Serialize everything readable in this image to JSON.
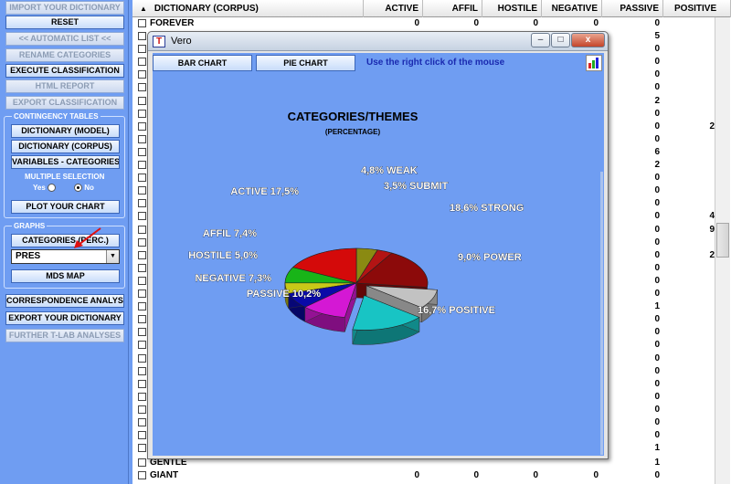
{
  "left_panel": {
    "buttons_top": [
      {
        "label": "IMPORT YOUR DICTIONARY",
        "enabled": false
      },
      {
        "label": "RESET",
        "enabled": true
      },
      {
        "label": "<< AUTOMATIC LIST <<",
        "enabled": false
      },
      {
        "label": "RENAME CATEGORIES",
        "enabled": false
      },
      {
        "label": "EXECUTE CLASSIFICATION",
        "enabled": true
      },
      {
        "label": "HTML REPORT",
        "enabled": false
      },
      {
        "label": "EXPORT CLASSIFICATION",
        "enabled": false
      }
    ],
    "contingency": {
      "title": "CONTINGENCY TABLES",
      "buttons": [
        "DICTIONARY (MODEL)",
        "DICTIONARY (CORPUS)",
        "VARIABLES - CATEGORIES"
      ],
      "multiple_selection": "MULTIPLE SELECTION",
      "yes_label": "Yes",
      "no_label": "No",
      "plot_button": "PLOT YOUR CHART"
    },
    "graphs": {
      "title": "GRAPHS",
      "categories_button": "CATEGORIES (PERC.)",
      "select_value": "PRES",
      "mds_button": "MDS MAP"
    },
    "buttons_bottom": [
      {
        "label": "CORRESPONDENCE ANALYSIS",
        "enabled": true
      },
      {
        "label": "EXPORT YOUR DICTIONARY",
        "enabled": true
      },
      {
        "label": "FURTHER T-LAB ANALYSES",
        "enabled": false
      }
    ]
  },
  "table": {
    "sort_icon": "triangle-up-icon",
    "columns": [
      "DICTIONARY (CORPUS)",
      "ACTIVE",
      "AFFIL",
      "HOSTILE",
      "NEGATIVE",
      "PASSIVE",
      "POSITIVE"
    ],
    "first_row": {
      "word": "FOREVER",
      "values": [
        "0",
        "0",
        "0",
        "0",
        "0",
        ""
      ]
    },
    "passive_column": [
      "5",
      "0",
      "0",
      "0",
      "0",
      "2",
      "0",
      "0",
      "0",
      "6",
      "2",
      "0",
      "0",
      "0",
      "0",
      "0",
      "0",
      "0",
      "0",
      "0",
      "0",
      "1",
      "0",
      "0",
      "0",
      "0",
      "0",
      "0",
      "0",
      "0",
      "0",
      "0",
      "1"
    ],
    "positive_column_partial": [
      {
        "index": 7,
        "value": "2"
      },
      {
        "index": 14,
        "value": "4"
      },
      {
        "index": 15,
        "value": "9"
      },
      {
        "index": 17,
        "value": "2"
      }
    ],
    "partial_row": {
      "word": "GENTLE",
      "passive": "1"
    },
    "last_row": {
      "word": "GIANT",
      "values": [
        "0",
        "0",
        "0",
        "0",
        "0",
        ""
      ]
    }
  },
  "window": {
    "title": "Vero",
    "app_icon_letter": "T",
    "minimize_icon": "minimize-icon",
    "maximize_icon": "maximize-icon",
    "close_icon": "close-icon",
    "minimize_glyph": "–",
    "maximize_glyph": "□",
    "close_glyph": "x",
    "bar_chart_label": "BAR CHART",
    "pie_chart_label": "PIE CHART",
    "hint": "Use the right click of the mouse",
    "toolbar_icon": "chart-export-icon"
  },
  "chart_data": {
    "type": "pie",
    "title": "CATEGORIES/THEMES",
    "subtitle": "(PERCENTAGE)",
    "slices": [
      {
        "name": "WEAK",
        "value": 4.8,
        "label": "4,8%  WEAK",
        "color": "#8a8a12"
      },
      {
        "name": "SUBMIT",
        "value": 3.5,
        "label": "3,5%  SUBMIT",
        "color": "#b31414"
      },
      {
        "name": "STRONG",
        "value": 18.6,
        "label": "18,6%  STRONG",
        "color": "#8c0a0a"
      },
      {
        "name": "POWER",
        "value": 9.0,
        "label": "9,0%  POWER",
        "color": "#c2c2c2"
      },
      {
        "name": "POSITIVE",
        "value": 16.7,
        "label": "16,7%  POSITIVE",
        "color": "#18c4c4"
      },
      {
        "name": "PASSIVE",
        "value": 10.2,
        "label": "PASSIVE  10,2%",
        "color": "#d418d4"
      },
      {
        "name": "NEGATIVE",
        "value": 7.3,
        "label": "NEGATIVE  7,3%",
        "color": "#0a0aa8"
      },
      {
        "name": "HOSTILE",
        "value": 5.0,
        "label": "HOSTILE  5,0%",
        "color": "#c8c818"
      },
      {
        "name": "AFFIL",
        "value": 7.4,
        "label": "AFFIL  7,4%",
        "color": "#18b418"
      },
      {
        "name": "ACTIVE",
        "value": 17.5,
        "label": "ACTIVE  17,5%",
        "color": "#d40a0a"
      }
    ],
    "exploded": [
      "POSITIVE",
      "POWER"
    ]
  }
}
